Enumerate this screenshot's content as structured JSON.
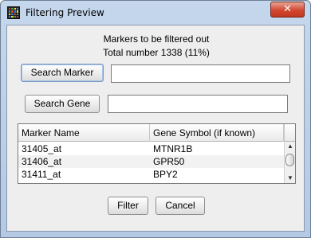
{
  "window": {
    "title": "Filtering Preview",
    "close_glyph": "✕"
  },
  "message": {
    "line1": "Markers to be filtered out",
    "line2": "Total number 1338 (11%)"
  },
  "search_marker": {
    "button_label": "Search Marker",
    "value": ""
  },
  "search_gene": {
    "button_label": "Search Gene",
    "value": ""
  },
  "table": {
    "columns": [
      "Marker Name",
      "Gene Symbol (if known)"
    ],
    "rows": [
      {
        "marker": "31405_at",
        "gene": "MTNR1B"
      },
      {
        "marker": "31406_at",
        "gene": "GPR50"
      },
      {
        "marker": "31411_at",
        "gene": "BPY2"
      }
    ],
    "scroll_up_icon": "▲",
    "scroll_down_icon": "▼"
  },
  "footer": {
    "filter_label": "Filter",
    "cancel_label": "Cancel"
  },
  "icons": {
    "app": "grid-app-icon",
    "close": "close-icon"
  },
  "colors": {
    "titlebar": "#b4c9e4",
    "close": "#d2472f",
    "client": "#eeeeee"
  }
}
